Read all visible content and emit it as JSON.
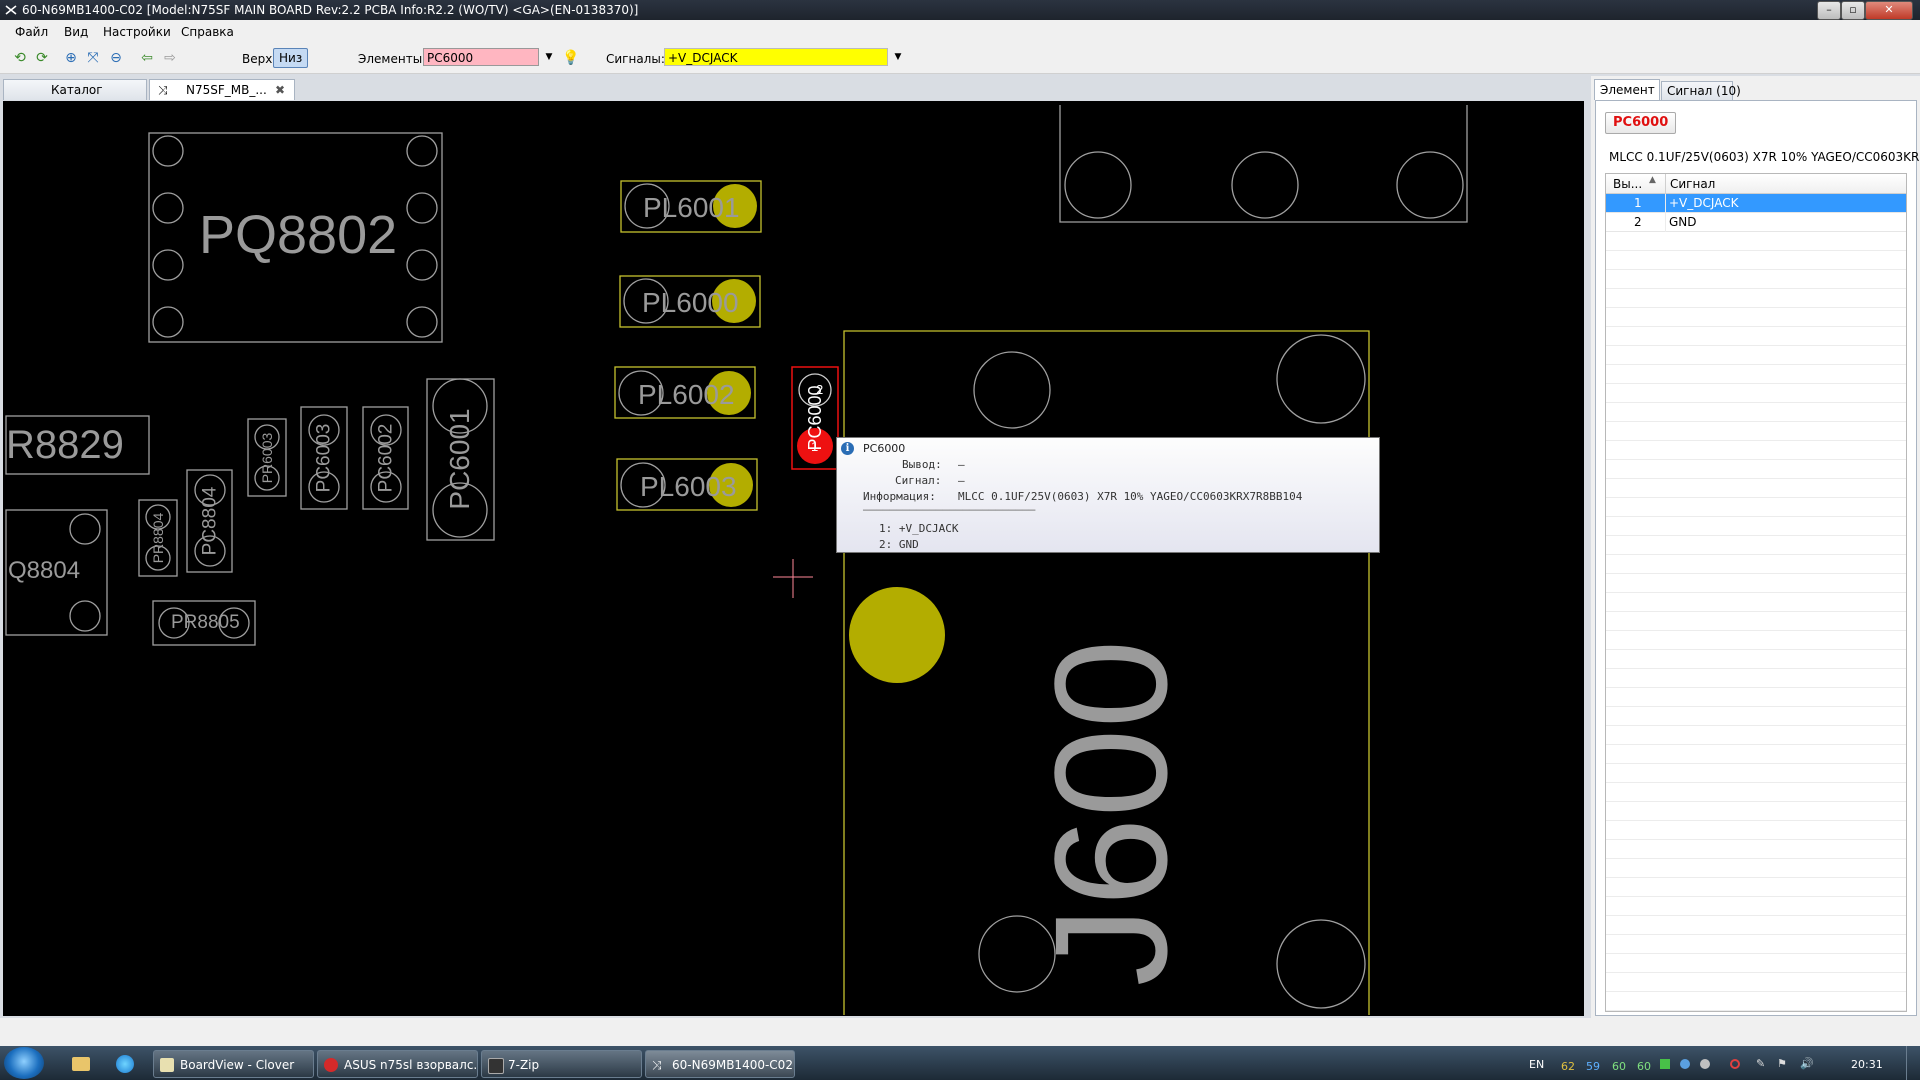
{
  "window": {
    "title": "60-N69MB1400-C02 [Model:N75SF MAIN BOARD Rev:2.2 PCBA Info:R2.2 (WO/TV) <GA>(EN-0138370)]",
    "minimize": "–",
    "maximize": "▫",
    "close": "✕"
  },
  "menu": [
    "Файл",
    "Вид",
    "Настройки",
    "Справка"
  ],
  "toolbar": {
    "top_label": "Верх",
    "bottom_label": "Низ",
    "elements_label": "Элементы:",
    "elements_value": "PC6000",
    "signals_label": "Сигналы:",
    "signals_value": "+V_DCJACK",
    "dropdown_arrow": "▼"
  },
  "tabs": [
    {
      "label": "Каталог"
    },
    {
      "label": "N75SF_MB_..."
    }
  ],
  "tab_close": "✖",
  "tab_icon": "⤨",
  "board": {
    "labels": {
      "pq8802": "PQ8802",
      "r8829": "R8829",
      "q8804": "Q8804",
      "pr8805": "PR8805",
      "pr8804": "PR8804",
      "pc8804": "PC8804",
      "pr6003": "PR6003",
      "pc6003": "PC6003",
      "pc6002": "PC6002",
      "pc6001": "PC6001",
      "pl6001": "PL6001",
      "pl6000": "PL6000",
      "pl6002": "PL6002",
      "pl6003": "PL6003",
      "pc6000": "PC6000",
      "j600": "J600"
    },
    "pin_marks": {
      "pin2": "2",
      "pin1": "1"
    }
  },
  "tooltip": {
    "title": "PC6000",
    "pin_label": "Вывод:",
    "pin_value": "—",
    "signal_label": "Сигнал:",
    "signal_value": "—",
    "info_label": "Информация:",
    "info_value": "MLCC 0.1UF/25V(0603) X7R 10% YAGEO/CC0603KRX7R8BB104",
    "separator": "──────────────────────────",
    "pins": [
      "1: +V_DCJACK",
      "2: GND"
    ],
    "info_icon": "i"
  },
  "right_panel": {
    "tabs": [
      "Элемент",
      "Сигнал (10)"
    ],
    "part_name": "PC6000",
    "description": "MLCC 0.1UF/25V(0603) X7R 10% YAGEO/CC0603KR",
    "columns": [
      "Вы...",
      "Сигнал"
    ],
    "sort_arrow": "▲",
    "rows": [
      {
        "pin": "1",
        "signal": "+V_DCJACK"
      },
      {
        "pin": "2",
        "signal": "GND"
      }
    ]
  },
  "taskbar": {
    "items": [
      "BoardView - Clover",
      "ASUS n75sl взорвалс...",
      "7-Zip",
      "60-N69MB1400-C02 ..."
    ],
    "lang": "EN",
    "temps": [
      "62",
      "59",
      "60",
      "60"
    ],
    "time": "20:31"
  },
  "colors": {
    "canvas_bg": "#000000",
    "pad_yellow": "#b3ad00",
    "outline_yellow": "#c6c22e",
    "selected_red": "#ee1111",
    "elements_field_bg": "#ffb6c1",
    "signals_field_bg": "#ffff00",
    "row_selected": "#3399ff"
  }
}
